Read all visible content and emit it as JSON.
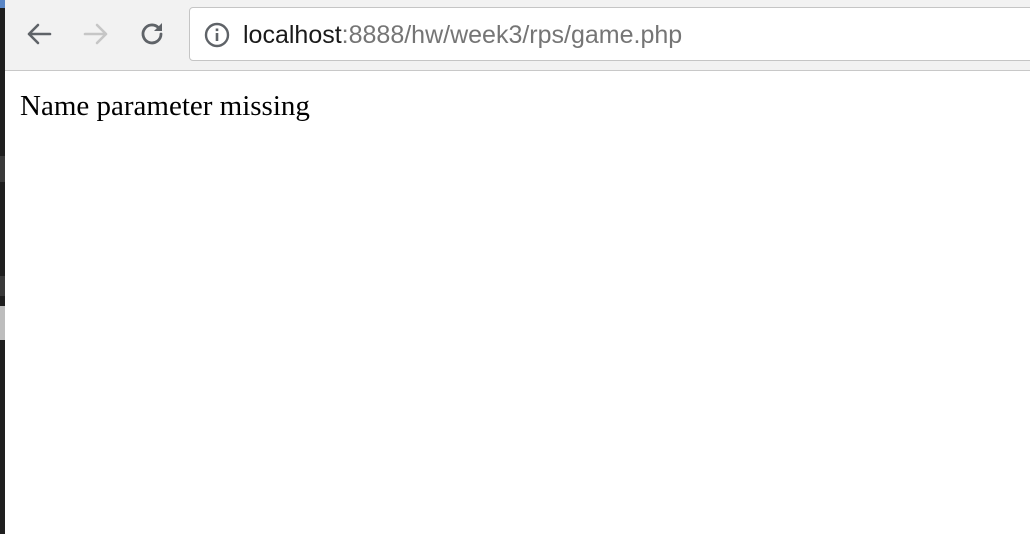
{
  "browser": {
    "back_icon": "arrow-left-icon",
    "forward_icon": "arrow-right-icon",
    "reload_icon": "reload-icon",
    "site_info_icon": "info-icon",
    "address": {
      "host": "localhost",
      "rest": ":8888/hw/week3/rps/game.php"
    }
  },
  "page": {
    "message": "Name parameter missing"
  },
  "colors": {
    "toolbar_bg": "#f2f2f2",
    "icon_active": "#5f6368",
    "icon_disabled": "#c6c6c6",
    "url_host": "#1a1a1a",
    "url_rest": "#757575"
  }
}
